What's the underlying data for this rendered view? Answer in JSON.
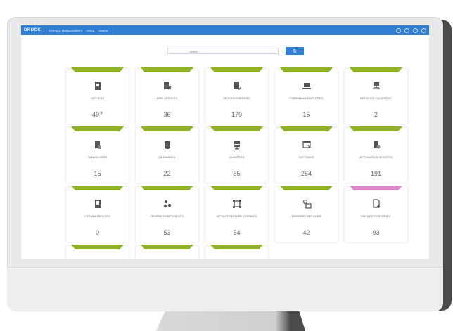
{
  "app": {
    "logo": "DRUCK",
    "title": "SERVICE MANAGEMENT",
    "nav": [
      "CMDB",
      "Search"
    ]
  },
  "search": {
    "placeholder": "Search"
  },
  "colors": {
    "green": "#8fb226",
    "pink": "#d987c6",
    "accent": "#2f7fd4"
  },
  "cards": [
    {
      "ribbon_color": "green",
      "icon": "server-icon",
      "label": "SERVERS",
      "count": "497"
    },
    {
      "ribbon_color": "green",
      "icon": "decommissioned-server-icon",
      "label": "DISK SERVERS",
      "count": "36"
    },
    {
      "ribbon_color": "green",
      "icon": "server-edit-icon",
      "label": "SERVICES DEVICES",
      "count": "179"
    },
    {
      "ribbon_color": "green",
      "icon": "laptop-icon",
      "label": "PERSONAL COMPUTERS",
      "count": "15"
    },
    {
      "ribbon_color": "green",
      "icon": "network-equipment-icon",
      "label": "NETWORK EQUIPMENT",
      "count": "2"
    },
    {
      "ribbon_color": "green",
      "icon": "document-server-icon",
      "label": "SAN DEVICES",
      "count": "15"
    },
    {
      "ribbon_color": "green",
      "icon": "database-icon",
      "label": "DATABASES",
      "count": "22"
    },
    {
      "ribbon_color": "green",
      "icon": "cluster-icon",
      "label": "CLUSTERS",
      "count": "55"
    },
    {
      "ribbon_color": "green",
      "icon": "software-window-icon",
      "label": "SOFTWARE",
      "count": "264"
    },
    {
      "ribbon_color": "green",
      "icon": "application-server-icon",
      "label": "APPLICATION SERVERS",
      "count": "191"
    },
    {
      "ribbon_color": "green",
      "icon": "virtual-server-icon",
      "label": "VIRTUAL SERVERS",
      "count": "0"
    },
    {
      "ribbon_color": "green",
      "icon": "components-icon",
      "label": "REUSED COMPONENTS",
      "count": "53"
    },
    {
      "ribbon_color": "green",
      "icon": "infrastructure-icon",
      "label": "INFRASTRUCTURE SERVICES",
      "count": "54"
    },
    {
      "ribbon_color": "green",
      "icon": "business-services-icon",
      "label": "BUSINESS SERVICES",
      "count": "42"
    },
    {
      "ribbon_color": "pink",
      "icon": "document-download-icon",
      "label": "DATA REPOSITORIES",
      "count": "93"
    }
  ],
  "partial_cards": [
    {
      "ribbon_color": "green"
    },
    {
      "ribbon_color": "green"
    },
    {
      "ribbon_color": "green"
    }
  ]
}
